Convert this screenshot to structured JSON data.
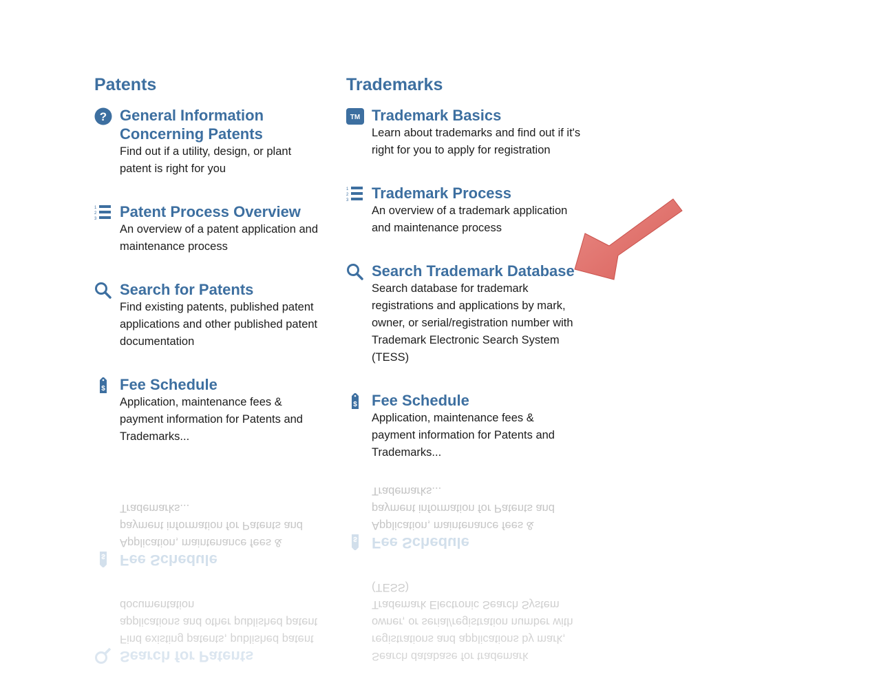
{
  "patents": {
    "heading": "Patents",
    "items": [
      {
        "title": "General Information Concerning Patents",
        "desc": "Find out if a utility, design, or plant patent is right for you",
        "icon": "question-circle-icon"
      },
      {
        "title": "Patent Process Overview",
        "desc": "An overview of a patent application and maintenance process",
        "icon": "numbered-list-icon"
      },
      {
        "title": "Search for Patents",
        "desc": "Find existing patents, published patent applications and other published patent documentation",
        "icon": "search-icon"
      },
      {
        "title": "Fee Schedule",
        "desc": "Application, maintenance fees & payment information for Patents and Trademarks...",
        "icon": "dollar-tag-icon"
      }
    ]
  },
  "trademarks": {
    "heading": "Trademarks",
    "items": [
      {
        "title": "Trademark Basics",
        "desc": "Learn about trademarks and find out if it's right for you to apply for registration",
        "icon": "tm-badge-icon"
      },
      {
        "title": "Trademark Process",
        "desc": "An overview of a trademark application and maintenance process",
        "icon": "numbered-list-icon"
      },
      {
        "title": "Search Trademark Database",
        "desc": "Search database for trademark registrations and applications by mark, owner, or serial/registration number with Trademark Electronic Search System (TESS)",
        "icon": "search-icon"
      },
      {
        "title": "Fee Schedule",
        "desc": "Application, maintenance fees & payment information for Patents and Trademarks...",
        "icon": "dollar-tag-icon"
      }
    ]
  },
  "colors": {
    "accent": "#3d6fa0",
    "text": "#1c1c1c",
    "arrow": "#e06b66"
  }
}
